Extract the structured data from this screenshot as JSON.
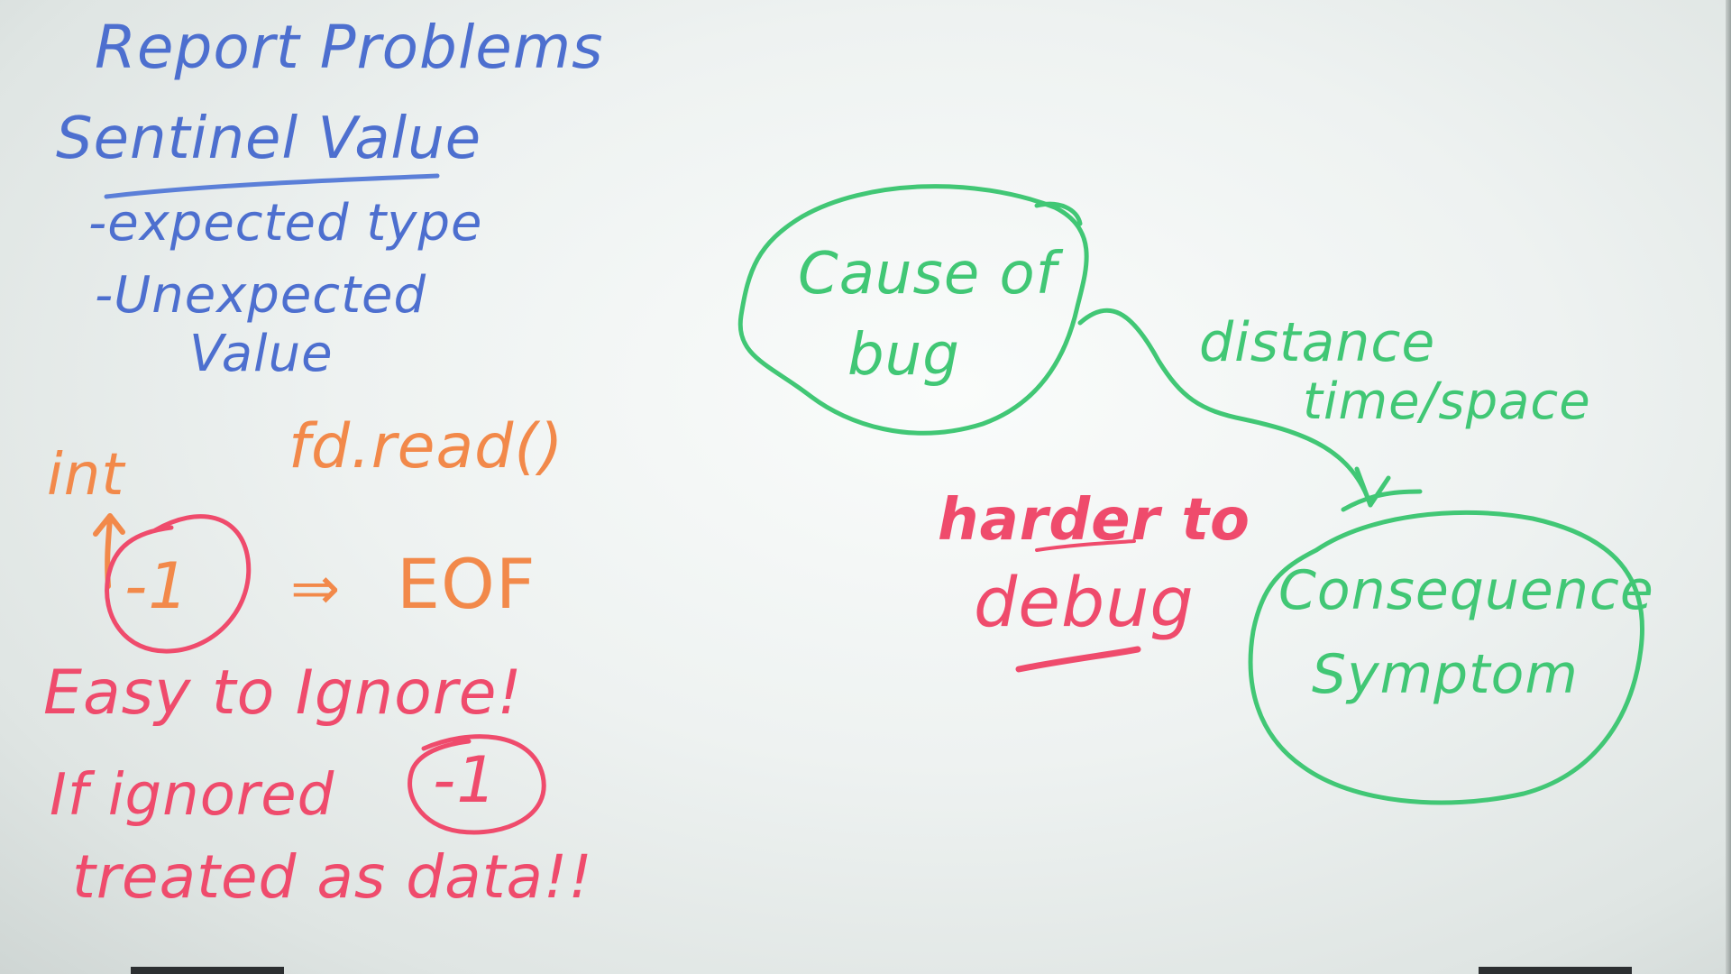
{
  "board": {
    "left_notes": {
      "title": "Report Problems",
      "subtitle": "Sentinel Value",
      "bullet_1": "-expected type",
      "bullet_2_line_1": "-Unexpected",
      "bullet_2_line_2": "Value"
    },
    "example": {
      "type_label": "int",
      "call_label": "fd.read()",
      "sentinel_value": "-1",
      "arrow_symbol": "⇒",
      "meaning": "EOF",
      "warning": "Easy to Ignore!",
      "if_ignored_label": "If ignored",
      "sentinel_value_again": "-1",
      "consequence_text": "treated as data!!"
    },
    "diagram": {
      "cause_line_1": "Cause of",
      "cause_line_2": "bug",
      "distance_line_1": "distance",
      "distance_line_2": "time/space",
      "harder_line_1": "harder to",
      "harder_line_2": "debug",
      "consequence_line_1": "Consequence",
      "consequence_line_2": "Symptom"
    },
    "colors": {
      "blue_marker": "#4d6fcf",
      "orange_marker": "#f2894a",
      "red_marker": "#ef4b6c",
      "green_marker": "#41c775"
    }
  }
}
